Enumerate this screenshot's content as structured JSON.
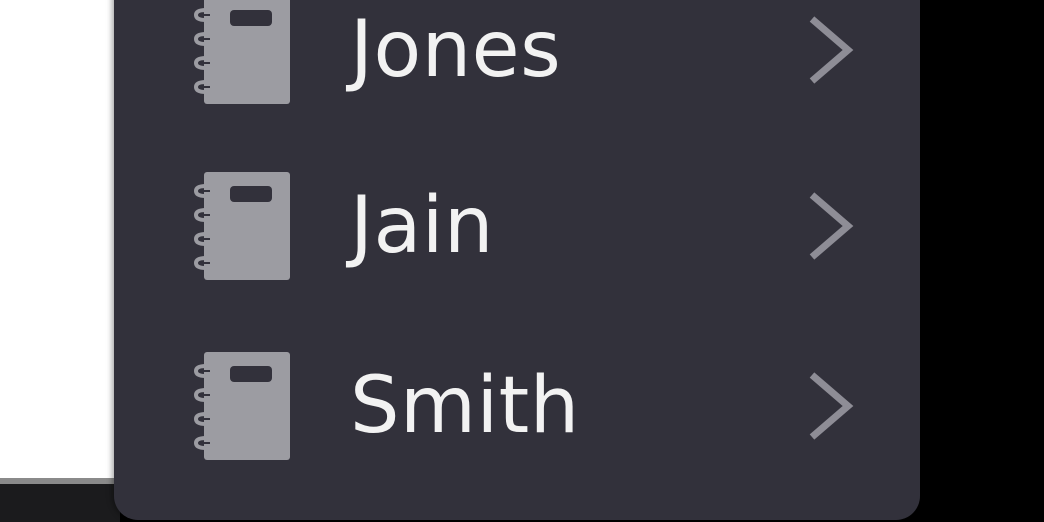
{
  "menu": {
    "items": [
      {
        "label": "Jones",
        "icon": "notebook-icon",
        "trailing_icon": "chevron-right-icon"
      },
      {
        "label": "Jain",
        "icon": "notebook-icon",
        "trailing_icon": "chevron-right-icon"
      },
      {
        "label": "Smith",
        "icon": "notebook-icon",
        "trailing_icon": "chevron-right-icon"
      }
    ]
  },
  "colors": {
    "menu_background": "#32313b",
    "label_text": "#f2f2f2",
    "icon_fill": "#9c9ca2",
    "chevron": "#8e8d96",
    "page_background": "#000000",
    "underlying_panel": "#ffffff"
  }
}
